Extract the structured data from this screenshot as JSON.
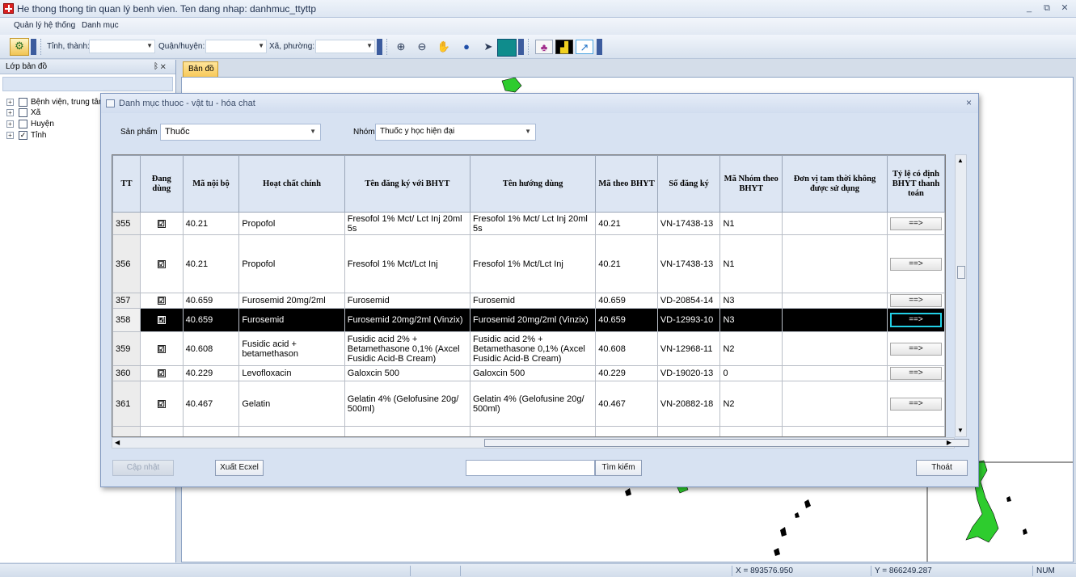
{
  "window": {
    "title": "He thong thong tin quan lý benh vien. Ten dang nhap: danhmuc_ttyttp",
    "controls": [
      "_",
      "⧉",
      "✕"
    ]
  },
  "menu": [
    "Quản lý hệ thống",
    "Danh mục"
  ],
  "toolbar": {
    "province_label": "Tỉnh, thành:",
    "district_label": "Quận/huyện:",
    "ward_label": "Xã, phường:",
    "province_value": "",
    "district_value": "",
    "ward_value": ""
  },
  "left_panel": {
    "title": "Lớp bản đồ",
    "pin": "ᛒ ✕",
    "layers": [
      {
        "label": "Bệnh viện, trung tâm y tế",
        "checked": false
      },
      {
        "label": "Xã",
        "checked": false
      },
      {
        "label": "Huyện",
        "checked": false
      },
      {
        "label": "Tỉnh",
        "checked": true
      }
    ]
  },
  "map_tab": "Bản đồ",
  "status": {
    "x": "X = 893576.950",
    "y": "Y = 866249.287",
    "num": "NUM"
  },
  "dialog": {
    "title": "Danh mục thuoc - vật tu - hóa chat",
    "close": "×",
    "product_label": "Sản phẩm",
    "product_value": "Thuốc",
    "group_label": "Nhóm",
    "group_value": "Thuốc y học hiện đại",
    "columns": [
      "TT",
      "Đang dùng",
      "Mã nội bộ",
      "Hoạt chất chính",
      "Tên đăng ký với BHYT",
      "Tên hướng dùng",
      "Mã theo BHYT",
      "Số đăng ký",
      "Mã Nhóm theo BHYT",
      "Đơn vị tam thời không được sử dụng",
      "Tỷ lệ có định BHYT thanh toán"
    ],
    "rows": [
      {
        "tt": "355",
        "active": "☑",
        "code": "40.21",
        "ingredient": "Propofol",
        "reg_name": "Fresofol 1% Mct/ Lct Inj 20ml 5s",
        "usage_name": "Fresofol 1% Mct/ Lct Inj 20ml 5s",
        "bhyt_code": "40.21",
        "reg_no": "VN-17438-13",
        "group": "N1",
        "unit": "",
        "ratio": "==>"
      },
      {
        "tt": "356",
        "active": "☑",
        "code": "40.21",
        "ingredient": "Propofol",
        "reg_name": "Fresofol 1% Mct/Lct Inj",
        "usage_name": "Fresofol 1% Mct/Lct Inj",
        "bhyt_code": "40.21",
        "reg_no": "VN-17438-13",
        "group": "N1",
        "unit": "",
        "ratio": "==>"
      },
      {
        "tt": "357",
        "active": "☑",
        "code": "40.659",
        "ingredient": "Furosemid 20mg/2ml",
        "reg_name": "Furosemid",
        "usage_name": "Furosemid",
        "bhyt_code": "40.659",
        "reg_no": "VD-20854-14",
        "group": "N3",
        "unit": "",
        "ratio": "==>"
      },
      {
        "tt": "358",
        "active": "☑",
        "code": "40.659",
        "ingredient": "Furosemid",
        "reg_name": "Furosemid 20mg/2ml (Vinzix)",
        "usage_name": "Furosemid 20mg/2ml (Vinzix)",
        "bhyt_code": "40.659",
        "reg_no": "VD-12993-10",
        "group": "N3",
        "unit": "",
        "ratio": "==>"
      },
      {
        "tt": "359",
        "active": "☑",
        "code": "40.608",
        "ingredient": "Fusidic acid + betamethason",
        "reg_name": "Fusidic acid 2% + Betamethasone 0,1% (Axcel Fusidic Acid-B Cream)",
        "usage_name": "Fusidic acid 2% + Betamethasone 0,1% (Axcel Fusidic Acid-B Cream)",
        "bhyt_code": "40.608",
        "reg_no": "VN-12968-11",
        "group": "N2",
        "unit": "",
        "ratio": "==>"
      },
      {
        "tt": "360",
        "active": "☑",
        "code": "40.229",
        "ingredient": "Levofloxacin",
        "reg_name": "Galoxcin 500",
        "usage_name": "Galoxcin 500",
        "bhyt_code": "40.229",
        "reg_no": "VD-19020-13",
        "group": "0",
        "unit": "",
        "ratio": "==>"
      },
      {
        "tt": "361",
        "active": "☑",
        "code": "40.467",
        "ingredient": "Gelatin",
        "reg_name": "Gelatin 4% (Gelofusine 20g/ 500ml)",
        "usage_name": "Gelatin 4% (Gelofusine 20g/ 500ml)",
        "bhyt_code": "40.467",
        "reg_no": "VN-20882-18",
        "group": "N2",
        "unit": "",
        "ratio": "==>"
      }
    ],
    "selected_row": 3,
    "buttons": {
      "update": "Cập nhật",
      "export": "Xuất Ecxel",
      "search": "Tìm kiếm",
      "exit": "Thoát"
    },
    "search_value": ""
  },
  "colors": {
    "selected_row_bg": "#000000",
    "focus_border": "#22d0e6",
    "map_land": "#2ecc2e"
  }
}
